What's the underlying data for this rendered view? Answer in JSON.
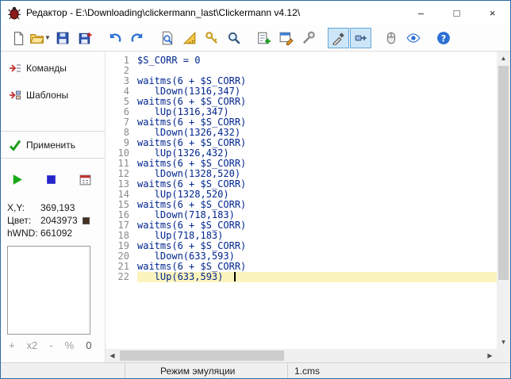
{
  "window": {
    "title": "Редактор - E:\\Downloading\\clickermann_last\\Clickermann v4.12\\",
    "controls": {
      "minimize": "–",
      "maximize": "□",
      "close": "×"
    }
  },
  "toolbar": {
    "buttons": [
      {
        "name": "new-file",
        "icon": "doc",
        "active": false
      },
      {
        "name": "open-file",
        "icon": "folder",
        "active": false,
        "dropdown": true
      },
      {
        "name": "save",
        "icon": "floppy",
        "active": false
      },
      {
        "name": "save-as",
        "icon": "floppy-plus",
        "active": false
      },
      {
        "name": "undo",
        "icon": "undo",
        "active": false
      },
      {
        "name": "redo",
        "icon": "redo",
        "active": false
      },
      {
        "name": "find-image",
        "icon": "page-search",
        "active": false
      },
      {
        "name": "ruler",
        "icon": "ruler",
        "active": false
      },
      {
        "name": "hotkeys",
        "icon": "keys",
        "active": false
      },
      {
        "name": "magnifier",
        "icon": "magnifier",
        "active": false
      },
      {
        "name": "add-command",
        "icon": "add-list",
        "active": false
      },
      {
        "name": "edit-script",
        "icon": "script",
        "active": false
      },
      {
        "name": "tools",
        "icon": "wrench-search",
        "active": false
      },
      {
        "name": "color-picker",
        "icon": "pipette",
        "active": true
      },
      {
        "name": "window-probe",
        "icon": "plug",
        "active": true
      },
      {
        "name": "mouse-recorder",
        "icon": "mouse",
        "active": false
      },
      {
        "name": "view",
        "icon": "eye",
        "active": false
      },
      {
        "name": "help",
        "icon": "help",
        "active": false
      }
    ]
  },
  "sidebar": {
    "commands_label": "Команды",
    "templates_label": "Шаблоны",
    "apply_label": "Применить",
    "stats": [
      {
        "label": "X,Y:",
        "value": "369,193"
      },
      {
        "label": "Цвет:",
        "value": "2043973",
        "swatch": "#45301F"
      },
      {
        "label": "hWND:",
        "value": "661092"
      }
    ],
    "zoom_controls": {
      "plus": "+",
      "scale": "x2",
      "minus": "-",
      "percent": "%",
      "zero": "0"
    }
  },
  "editor": {
    "current_line": 22,
    "lines": [
      "$S_CORR = 0",
      "",
      "waitms(6 + $S_CORR)",
      "   lDown(1316,347)",
      "waitms(6 + $S_CORR)",
      "   lUp(1316,347)",
      "waitms(6 + $S_CORR)",
      "   lDown(1326,432)",
      "waitms(6 + $S_CORR)",
      "   lUp(1326,432)",
      "waitms(6 + $S_CORR)",
      "   lDown(1328,520)",
      "waitms(6 + $S_CORR)",
      "   lUp(1328,520)",
      "waitms(6 + $S_CORR)",
      "   lDown(718,183)",
      "waitms(6 + $S_CORR)",
      "   lUp(718,183)",
      "waitms(6 + $S_CORR)",
      "   lDown(633,593)",
      "waitms(6 + $S_CORR)",
      "   lUp(633,593)"
    ]
  },
  "statusbar": {
    "mode": "Режим эмуляции",
    "file": "1.cms"
  }
}
